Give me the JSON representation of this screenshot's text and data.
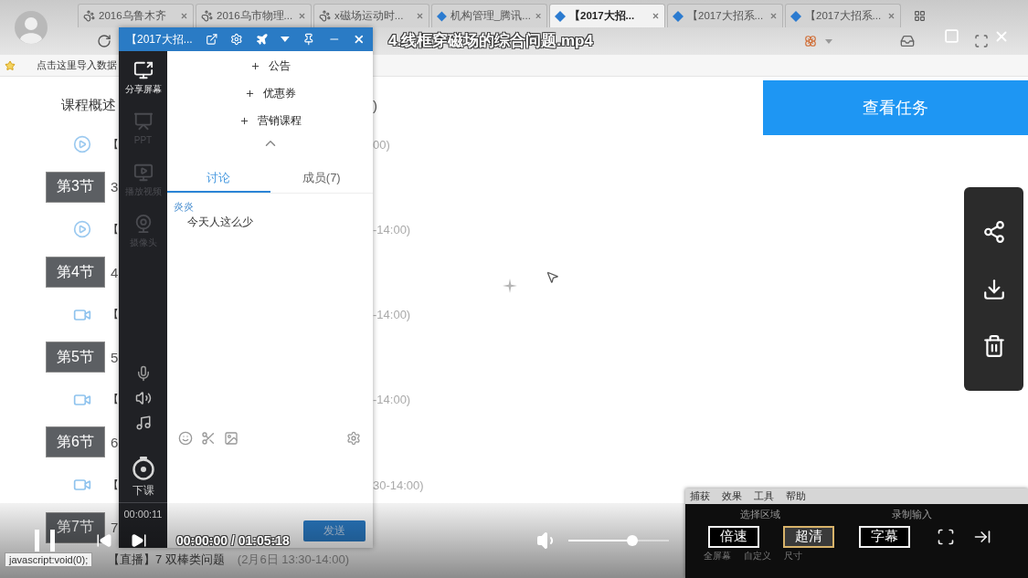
{
  "browser": {
    "tabs": [
      {
        "label": "2016乌鲁木齐",
        "kind": "paw",
        "selected": false
      },
      {
        "label": "2016乌市物理...",
        "kind": "paw",
        "selected": false
      },
      {
        "label": "x磁场运动时...",
        "kind": "paw",
        "selected": false
      },
      {
        "label": "机构管理_腾讯...",
        "kind": "diamond",
        "selected": false
      },
      {
        "label": "【2017大招...",
        "kind": "diamond",
        "selected": true
      },
      {
        "label": "【2017大招系...",
        "kind": "diamond",
        "selected": false
      },
      {
        "label": "【2017大招系...",
        "kind": "diamond",
        "selected": false
      }
    ],
    "bookmark": "点击这里导入数据"
  },
  "course": {
    "overview": "课程概述",
    "overview_tail": ")",
    "items": [
      {
        "kind": "replay",
        "lead": "【",
        "tail": "00)"
      },
      {
        "kind": "section",
        "label": "第3节",
        "lead": "3"
      },
      {
        "kind": "replay",
        "lead": "【",
        "tail": "-14:00)"
      },
      {
        "kind": "section",
        "label": "第4节",
        "lead": "4"
      },
      {
        "kind": "live",
        "lead": "【",
        "tail": "-14:00)"
      },
      {
        "kind": "section",
        "label": "第5节",
        "lead": "5"
      },
      {
        "kind": "live",
        "lead": "【",
        "tail": "-14:00)"
      },
      {
        "kind": "section",
        "label": "第6节",
        "lead": "6"
      },
      {
        "kind": "live",
        "lead": "【",
        "tail": "30-14:00)"
      },
      {
        "kind": "section",
        "label": "第7节",
        "lead": "7"
      },
      {
        "kind": "plain",
        "lead": "【直播】7 双棒类问题",
        "tail": "(2月6日 13:30-14:00)"
      }
    ]
  },
  "task_button": "查看任务",
  "live_panel": {
    "title": "【2017大招...",
    "tools": [
      {
        "label": "分享屏幕",
        "disabled": false
      },
      {
        "label": "PPT",
        "disabled": true
      },
      {
        "label": "播放视频",
        "disabled": true
      },
      {
        "label": "摄像头",
        "disabled": true
      }
    ],
    "end_label": "下课",
    "timer": "00:00:11",
    "actions": [
      "公告",
      "优惠券",
      "营销课程"
    ],
    "tabs": [
      {
        "label": "讨论",
        "selected": true
      },
      {
        "label": "成员(7)",
        "selected": false
      }
    ],
    "messages": [
      {
        "author": "炎炎",
        "text": "今天人这么少"
      }
    ],
    "send": "发送"
  },
  "player": {
    "title": "4.线框穿磁场的综合问题.mp4",
    "playing": true,
    "time": "00:00:00 / 01:05:18",
    "volume": {
      "level": 0.64
    }
  },
  "status_tooltip": "javascript:void(0);",
  "recorder": {
    "menu": [
      "捕获",
      "效果",
      "工具",
      "帮助"
    ],
    "groups": [
      "选择区域",
      "录制输入"
    ],
    "buttons": [
      {
        "label": "倍速",
        "selected": false
      },
      {
        "label": "超清",
        "selected": true
      },
      {
        "label": "字幕",
        "selected": false
      }
    ],
    "options": [
      "全屏幕",
      "自定义",
      "尺寸"
    ]
  }
}
